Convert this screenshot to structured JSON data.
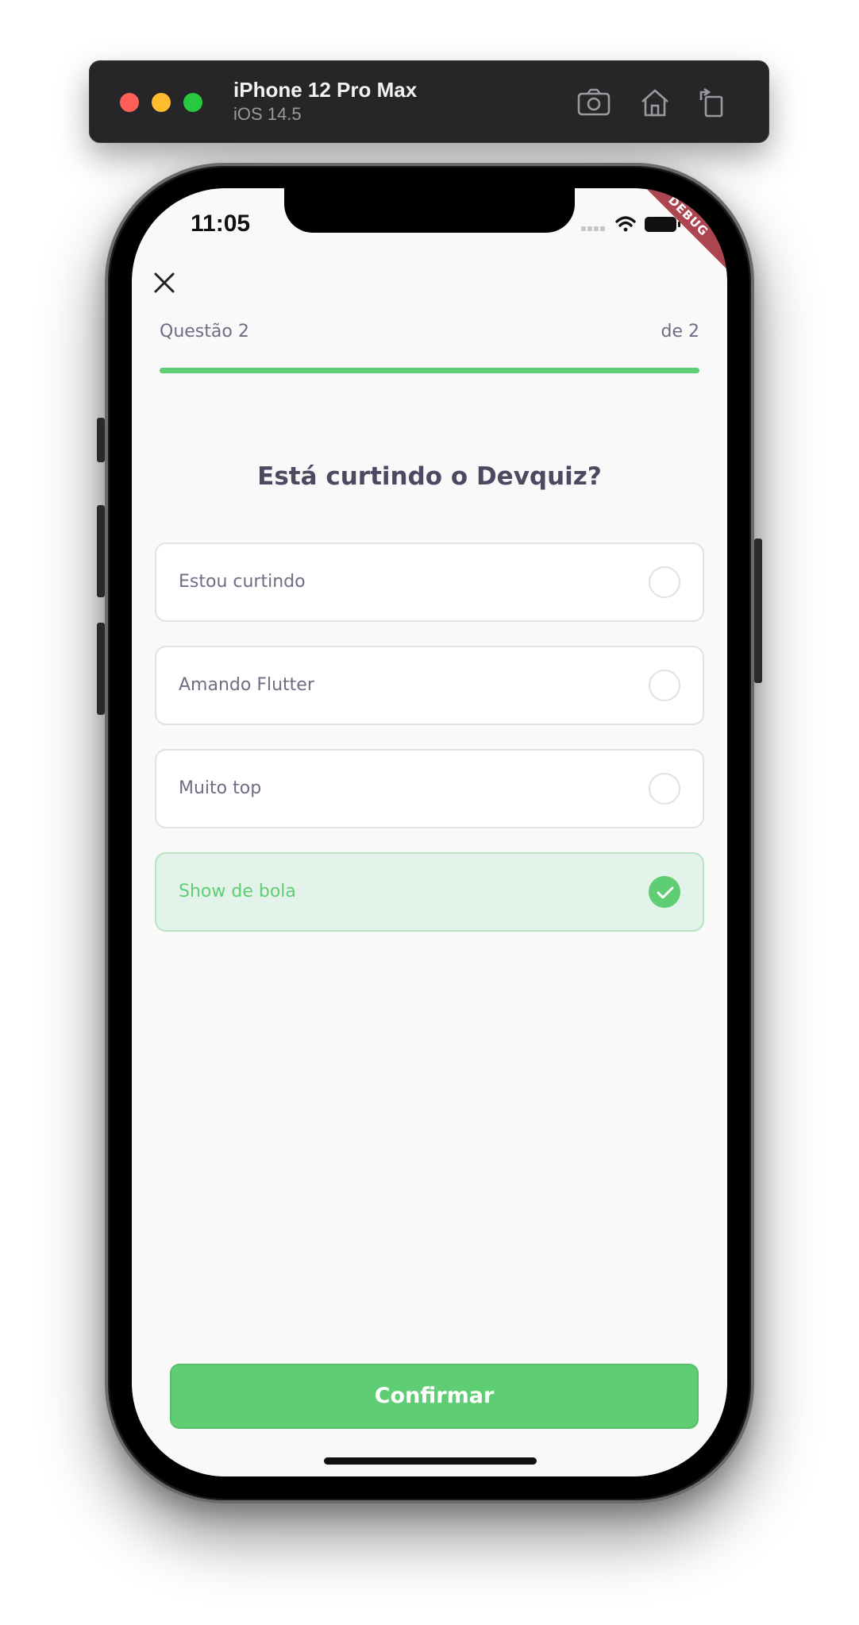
{
  "simulator": {
    "device_name": "iPhone 12 Pro Max",
    "os_version": "iOS 14.5",
    "tools": [
      "screenshot-icon",
      "home-icon",
      "rotate-icon"
    ]
  },
  "status_bar": {
    "time": "11:05",
    "debug_label": "DEBUG"
  },
  "quiz": {
    "question_label": "Questão 2",
    "total_label": "de 2",
    "progress": 1.0,
    "title": "Está curtindo o Devquiz?",
    "answers": [
      {
        "text": "Estou curtindo",
        "selected": false
      },
      {
        "text": "Amando Flutter",
        "selected": false
      },
      {
        "text": "Muito top",
        "selected": false
      },
      {
        "text": "Show de bola",
        "selected": true
      }
    ],
    "confirm_label": "Confirmar"
  },
  "colors": {
    "accent": "#5fcd73",
    "title": "#4b4a61",
    "text": "#6f6d84",
    "border": "#e1e1e6",
    "selected_bg": "#e4f3ea"
  }
}
